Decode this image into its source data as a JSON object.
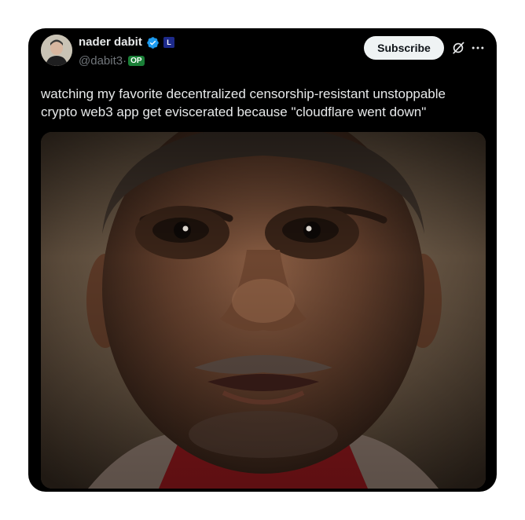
{
  "post": {
    "author": {
      "name": "nader dabit",
      "handle": "@dabit3",
      "separator": "·",
      "op_label": "OP",
      "affiliate_badge": "L"
    },
    "subscribe_label": "Subscribe",
    "text": "watching my favorite decentralized censorship-resistant unstoppable\ncrypto web3 app get eviscerated because \"cloudflare went down\"",
    "icons": {
      "verified": "verified-badge-icon",
      "grok": "grok-icon",
      "more": "more-options-icon"
    },
    "colors": {
      "card_bg": "#000000",
      "text": "#e7e9ea",
      "secondary": "#71767b",
      "verified": "#1d9bf0",
      "op_badge": "#1a7f37",
      "subscribe_bg": "#eff3f4"
    }
  }
}
